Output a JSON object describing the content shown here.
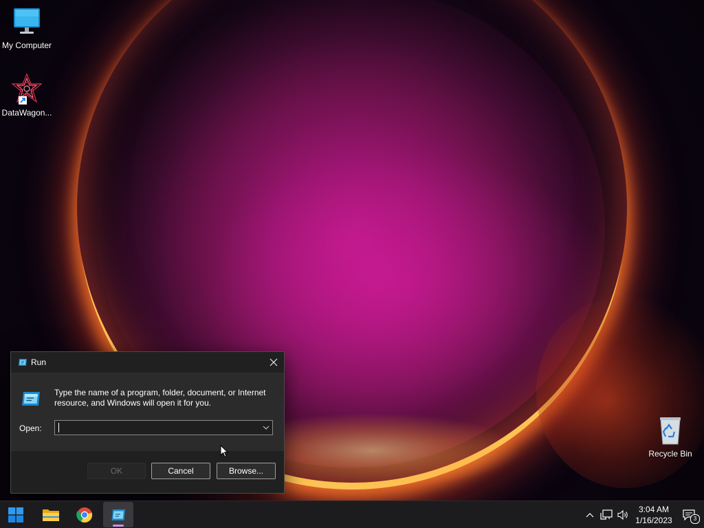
{
  "desktop": {
    "icons": [
      {
        "label": "My Computer",
        "icon": "monitor-icon"
      },
      {
        "label": "DataWagon...",
        "icon": "datawagon-app-icon",
        "is_shortcut": true
      },
      {
        "label": "Recycle Bin",
        "icon": "recycle-bin-icon"
      }
    ]
  },
  "run_dialog": {
    "title": "Run",
    "title_icon": "run-icon",
    "instructions": "Type the name of a program, folder, document, or Internet resource, and Windows will open it for you.",
    "open_label": "Open:",
    "open_value": "",
    "buttons": {
      "ok": "OK",
      "cancel": "Cancel",
      "browse": "Browse..."
    },
    "ok_enabled": false
  },
  "taskbar": {
    "items": [
      {
        "name": "start",
        "icon": "windows-logo-icon"
      },
      {
        "name": "file-explorer",
        "icon": "folder-icon"
      },
      {
        "name": "chrome",
        "icon": "chrome-icon"
      },
      {
        "name": "run",
        "icon": "run-icon",
        "active": true
      }
    ],
    "tray": {
      "icons": [
        "chevron-up-icon",
        "network-icon",
        "volume-icon"
      ],
      "time": "3:04 AM",
      "date": "1/16/2023",
      "notification_count": "3"
    }
  },
  "colors": {
    "taskbar": "#1c1c1e",
    "dialog_bg": "#2b2b2b",
    "dialog_footer": "#202020",
    "run_accent": "#4fc3f7",
    "active_indicator": "#c790e8"
  }
}
